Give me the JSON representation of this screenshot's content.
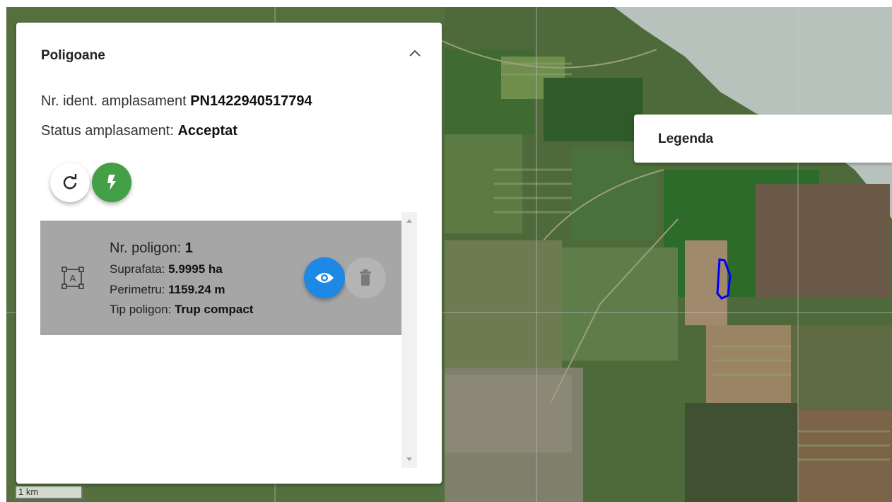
{
  "panel": {
    "title": "Poligoane",
    "site_id_label": "Nr. ident. amplasament ",
    "site_id_value": "PN1422940517794",
    "status_label": "Status amplasament: ",
    "status_value": "Acceptat"
  },
  "polygon": {
    "number_label": "Nr. poligon: ",
    "number_value": "1",
    "area_label": "Suprafata: ",
    "area_value": "5.9995 ha",
    "perimeter_label": "Perimetru: ",
    "perimeter_value": "1159.24 m",
    "type_label": "Tip poligon: ",
    "type_value": "Trup compact"
  },
  "legend": {
    "title": "Legenda"
  },
  "scale": {
    "label": "1 km"
  },
  "icons": [
    "chevron-up-icon",
    "refresh-icon",
    "flash-icon",
    "polygon-shape-icon",
    "eye-icon",
    "trash-icon"
  ],
  "colors": {
    "flash_button": "#43a047",
    "eye_button": "#1e88e5",
    "polygon_outline": "#0000ff",
    "item_background": "#a6a6a6"
  }
}
